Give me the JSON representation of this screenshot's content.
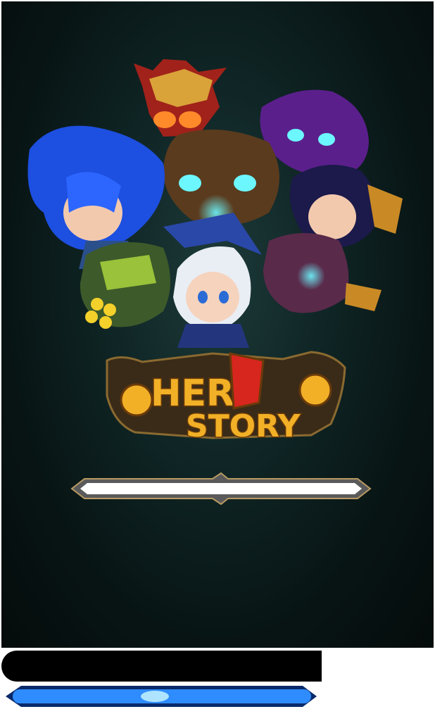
{
  "logo": {
    "word1": "HER",
    "word2": "STORY"
  },
  "loading": {
    "progress_fraction": 0,
    "bottom_progress_fraction": 1.0
  },
  "colors": {
    "background": "#081414",
    "logo_gold": "#f2b027",
    "progress_blue": "#2f8cff"
  }
}
